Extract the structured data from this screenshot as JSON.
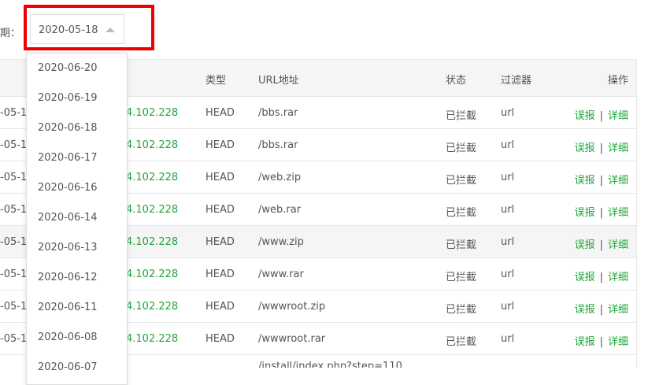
{
  "filter": {
    "label": "期：",
    "selected_date": "2020-05-18"
  },
  "dropdown": {
    "options": [
      "2020-06-20",
      "2020-06-19",
      "2020-06-18",
      "2020-06-17",
      "2020-06-16",
      "2020-06-14",
      "2020-06-13",
      "2020-06-12",
      "2020-06-11",
      "2020-06-08",
      "2020-06-07"
    ]
  },
  "table": {
    "headers": {
      "type": "类型",
      "url": "URL地址",
      "status": "状态",
      "filter": "过滤器",
      "ops": "操作"
    },
    "rows": [
      {
        "time": "-05-1",
        "ip": "4.102.228",
        "type": "HEAD",
        "url": "/bbs.rar",
        "status": "已拦截",
        "filter": "url"
      },
      {
        "time": "-05-1",
        "ip": "4.102.228",
        "type": "HEAD",
        "url": "/bbs.rar",
        "status": "已拦截",
        "filter": "url"
      },
      {
        "time": "-05-1",
        "ip": "4.102.228",
        "type": "HEAD",
        "url": "/web.zip",
        "status": "已拦截",
        "filter": "url"
      },
      {
        "time": "-05-1",
        "ip": "4.102.228",
        "type": "HEAD",
        "url": "/web.rar",
        "status": "已拦截",
        "filter": "url"
      },
      {
        "time": "-05-1",
        "ip": "4.102.228",
        "type": "HEAD",
        "url": "/www.zip",
        "status": "已拦截",
        "filter": "url"
      },
      {
        "time": "-05-1",
        "ip": "4.102.228",
        "type": "HEAD",
        "url": "/www.rar",
        "status": "已拦截",
        "filter": "url"
      },
      {
        "time": "-05-1",
        "ip": "4.102.228",
        "type": "HEAD",
        "url": "/wwwroot.zip",
        "status": "已拦截",
        "filter": "url"
      },
      {
        "time": "-05-1",
        "ip": "4.102.228",
        "type": "HEAD",
        "url": "/wwwroot.rar",
        "status": "已拦截",
        "filter": "url"
      }
    ],
    "partial_row_url": "/install/index.php?step=110",
    "ops": {
      "report": "误报",
      "separator": "|",
      "detail": "详细"
    }
  }
}
